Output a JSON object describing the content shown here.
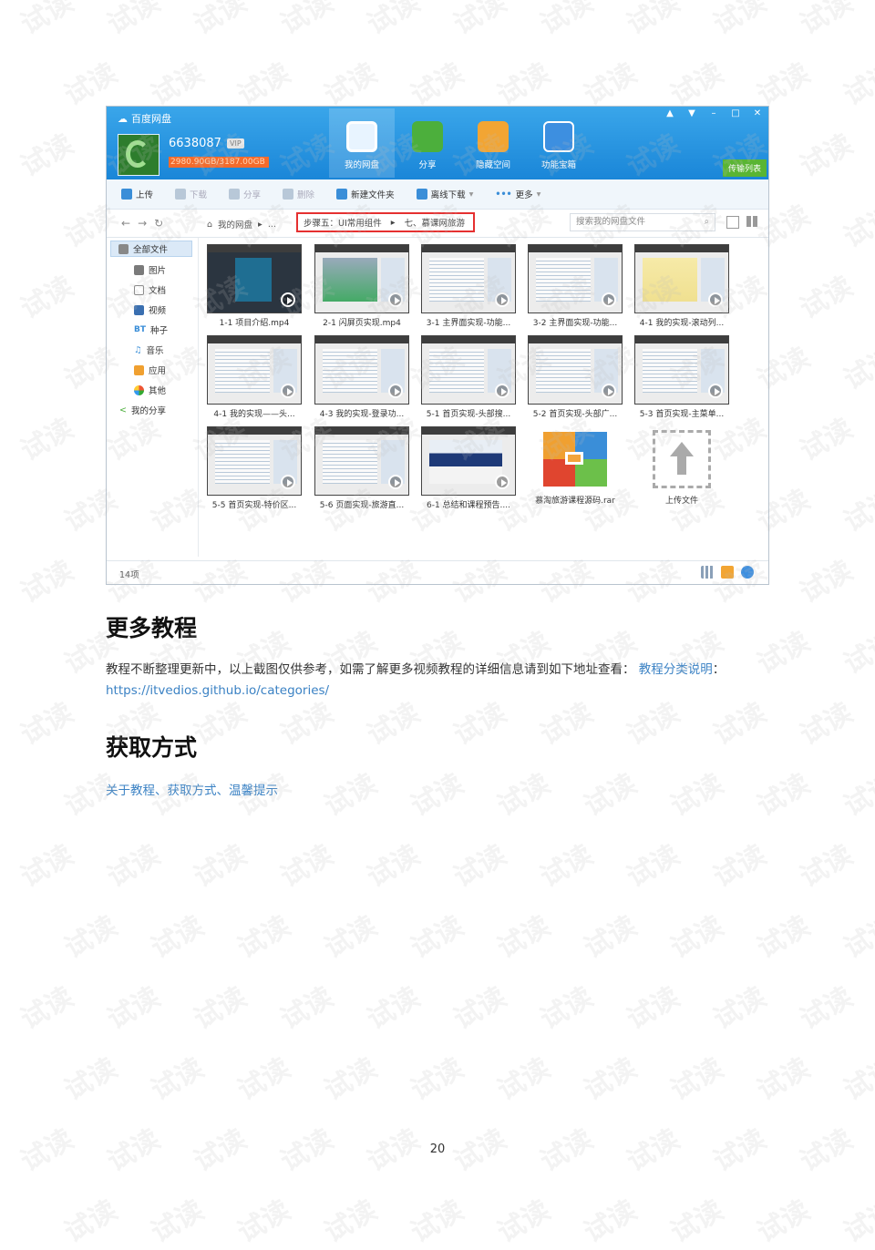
{
  "app": {
    "name": "百度网盘",
    "user_id": "6638087",
    "vip": "VIP",
    "quota": "2980.90GB/3187.00GB",
    "nav": [
      "我的网盘",
      "分享",
      "隐藏空间",
      "功能宝箱"
    ],
    "window_controls": [
      "▲",
      "▼",
      "–",
      "□",
      "✕"
    ],
    "transfer_list": "传输列表",
    "toolbar": [
      "上传",
      "下载",
      "分享",
      "删除",
      "新建文件夹",
      "离线下载",
      "更多"
    ],
    "breadcrumb": {
      "root": "我的网盘",
      "ellipsis": "...",
      "step": "步骤五：UI常用组件",
      "folder": "七、慕课网旅游"
    },
    "search_placeholder": "搜索我的网盘文件",
    "sidebar": [
      "全部文件",
      "图片",
      "文档",
      "视频",
      "种子",
      "音乐",
      "应用",
      "其他",
      "我的分享"
    ],
    "sidebar_bt": "BT",
    "files": [
      "1-1 项目介绍.mp4",
      "2-1 闪屏页实现.mp4",
      "3-1 主界面实现-功能...",
      "3-2 主界面实现-功能...",
      "4-1 我的实现-滚动列...",
      "4-1 我的实现——头...",
      "4-3 我的实现-登录功...",
      "5-1 首页实现-头部搜...",
      "5-2 首页实现-头部广...",
      "5-3 首页实现-主菜单...",
      "5-5 首页实现-特价区...",
      "5-6 页面实现-旅游直...",
      "6-1 总结和课程预告....",
      "慕淘旅游课程源码.rar",
      "上传文件"
    ],
    "status_count": "14项"
  },
  "doc": {
    "heading_more": "更多教程",
    "para_text": "教程不断整理更新中，以上截图仅供参考，如需了解更多视频教程的详细信息请到如下地址查看：",
    "para_link_label": "教程分类说明",
    "para_colon": "：",
    "para_url": "https://itvedios.github.io/categories/",
    "heading_get": "获取方式",
    "get_link": "关于教程、获取方式、温馨提示",
    "page_number": "20"
  },
  "watermark": "试读",
  "colors": {
    "header_blue": "#1a86d8",
    "link_blue": "#3b82c4",
    "highlight_red": "#e53030",
    "transfer_green": "#59b533"
  }
}
